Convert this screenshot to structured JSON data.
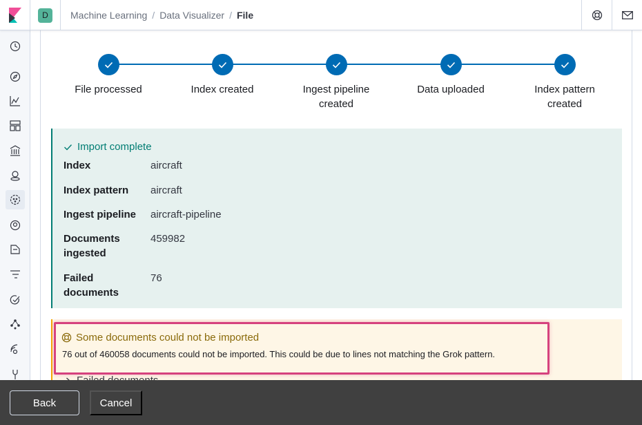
{
  "header": {
    "space_initial": "D",
    "breadcrumbs": [
      "Machine Learning",
      "Data Visualizer",
      "File"
    ],
    "separator": "/"
  },
  "sidenav": {
    "icons": [
      "recent-icon",
      "discover-icon",
      "visualize-icon",
      "dashboard-icon",
      "canvas-icon",
      "maps-icon",
      "machine-learning-icon",
      "metrics-icon",
      "logs-icon",
      "apm-icon",
      "uptime-icon",
      "graph-icon",
      "siem-icon",
      "dev-tools-icon"
    ]
  },
  "steps": [
    {
      "label": "File processed"
    },
    {
      "label": "Index created"
    },
    {
      "label": "Ingest pipeline created"
    },
    {
      "label": "Data uploaded"
    },
    {
      "label": "Index pattern created"
    }
  ],
  "success": {
    "title": "Import complete",
    "rows": [
      {
        "key": "Index",
        "value": "aircraft"
      },
      {
        "key": "Index pattern",
        "value": "aircraft"
      },
      {
        "key": "Ingest pipeline",
        "value": "aircraft-pipeline"
      },
      {
        "key": "Documents ingested",
        "value": "459982"
      },
      {
        "key": "Failed documents",
        "value": "76"
      }
    ]
  },
  "warning": {
    "title": "Some documents could not be imported",
    "body": "76 out of 460058 documents could not be imported. This could be due to lines not matching the Grok pattern.",
    "toggle": "Failed documents"
  },
  "footer": {
    "back_label": "Back",
    "cancel_label": "Cancel"
  },
  "colors": {
    "primary": "#006bb4",
    "success": "#017d73",
    "warning": "#f5a700",
    "highlight": "#d6427e"
  }
}
